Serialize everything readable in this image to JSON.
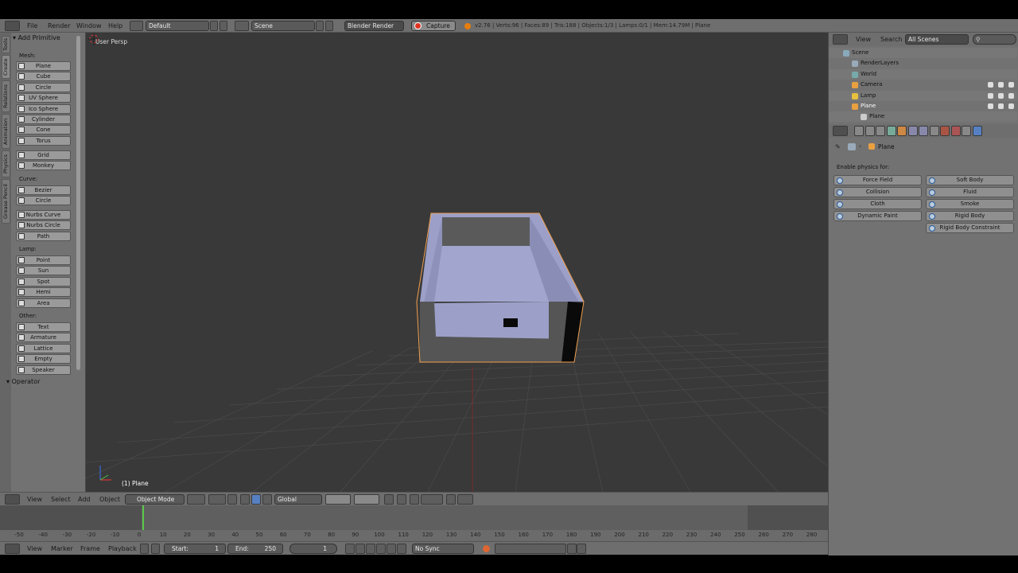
{
  "top_menu": {
    "file": "File",
    "render": "Render",
    "window": "Window",
    "help": "Help",
    "layout": "Default",
    "scene": "Scene",
    "engine": "Blender Render",
    "capture": "Capture",
    "stats": "v2.76 | Verts:96 | Faces:89 | Tris:188 | Objects:1/3 | Lamps:0/1 | Mem:14.79M | Plane"
  },
  "toolshelf": {
    "tabs": [
      "Tools",
      "Create",
      "Relations",
      "Animation",
      "Physics",
      "Grease Pencil"
    ],
    "panel_title": "Add Primitive",
    "mesh_label": "Mesh:",
    "mesh": [
      "Plane",
      "Cube",
      "Circle",
      "UV Sphere",
      "Ico Sphere",
      "Cylinder",
      "Cone",
      "Torus"
    ],
    "mesh2": [
      "Grid",
      "Monkey"
    ],
    "curve_label": "Curve:",
    "curve": [
      "Bezier",
      "Circle"
    ],
    "curve2": [
      "Nurbs Curve",
      "Nurbs Circle",
      "Path"
    ],
    "lamp_label": "Lamp:",
    "lamp": [
      "Point",
      "Sun",
      "Spot",
      "Hemi",
      "Area"
    ],
    "other_label": "Other:",
    "other": [
      "Text",
      "Armature",
      "Lattice",
      "Empty",
      "Speaker"
    ],
    "operator": "Operator"
  },
  "viewport": {
    "view_name": "User Persp",
    "object_label": "(1) Plane"
  },
  "viewport_header": {
    "view": "View",
    "select": "Select",
    "add": "Add",
    "object": "Object",
    "mode": "Object Mode",
    "orientation": "Global"
  },
  "timeline": {
    "ticks": [
      "-50",
      "-40",
      "-30",
      "-20",
      "-10",
      "0",
      "10",
      "20",
      "30",
      "40",
      "50",
      "60",
      "70",
      "80",
      "90",
      "100",
      "110",
      "120",
      "130",
      "140",
      "150",
      "160",
      "170",
      "180",
      "190",
      "200",
      "210",
      "220",
      "230",
      "240",
      "250",
      "260",
      "270",
      "280"
    ],
    "view": "View",
    "marker": "Marker",
    "frame": "Frame",
    "playback": "Playback",
    "start_label": "Start:",
    "start": "1",
    "end_label": "End:",
    "end": "250",
    "current": "1",
    "sync": "No Sync"
  },
  "outliner": {
    "view": "View",
    "search": "Search",
    "filter": "All Scenes",
    "rows": [
      {
        "label": "Scene",
        "indent": 0
      },
      {
        "label": "RenderLayers",
        "indent": 1
      },
      {
        "label": "World",
        "indent": 1
      },
      {
        "label": "Camera",
        "indent": 1
      },
      {
        "label": "Lamp",
        "indent": 1
      },
      {
        "label": "Plane",
        "indent": 1
      },
      {
        "label": "Plane",
        "indent": 2
      }
    ]
  },
  "properties": {
    "breadcrumb": "Plane",
    "enable_label": "Enable physics for:",
    "left": [
      "Force Field",
      "Collision",
      "Cloth",
      "Dynamic Paint"
    ],
    "right": [
      "Soft Body",
      "Fluid",
      "Smoke",
      "Rigid Body",
      "Rigid Body Constraint"
    ]
  },
  "colors": {
    "viewport_bg": "#393939",
    "panel_bg": "#727272",
    "selection_outline": "#f0a050",
    "mesh_face": "#9a9ec8",
    "mesh_shadow": "#555555"
  }
}
